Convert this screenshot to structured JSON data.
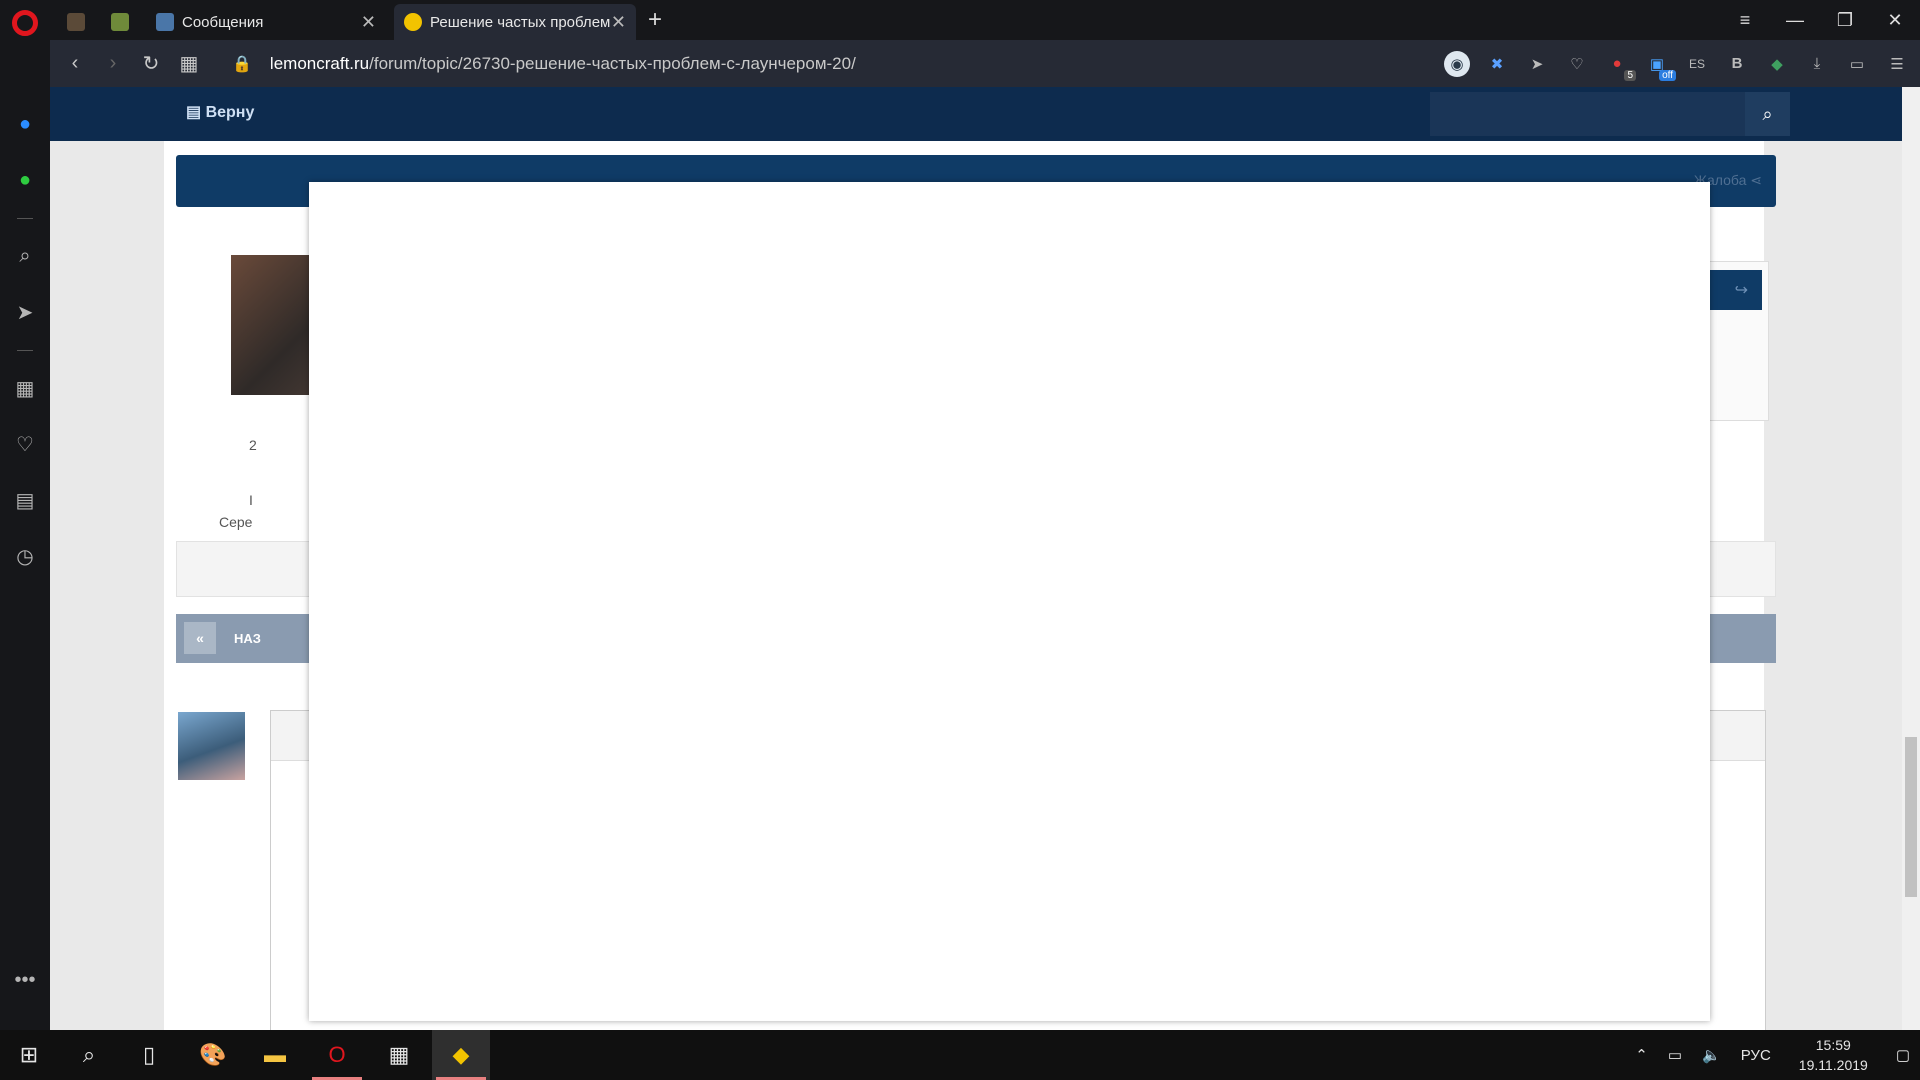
{
  "browser": {
    "tabs": [
      {
        "label": "",
        "icon": "minecraft-character-favicon",
        "pinned": true
      },
      {
        "label": "",
        "icon": "minecraft-block-favicon",
        "pinned": true
      },
      {
        "label": "Сообщения",
        "icon": "vk-messages-favicon",
        "pinned": false
      },
      {
        "label": "Решение частых проблем",
        "icon": "lemon-favicon",
        "pinned": false,
        "active": true
      }
    ],
    "address": {
      "host": "lemoncraft.ru",
      "path": "/forum/topic/26730-решение-частых-проблем-с-лаунчером-20/"
    },
    "extensions": [
      {
        "icon": "camera-icon"
      },
      {
        "icon": "blocker-icon"
      },
      {
        "icon": "send-icon"
      },
      {
        "icon": "heart-icon"
      },
      {
        "icon": "adblock-icon",
        "badge": "5"
      },
      {
        "icon": "sale-off-icon",
        "badge": "off"
      },
      {
        "icon": "es-icon",
        "label": "ES"
      },
      {
        "icon": "b-icon",
        "label": "B"
      },
      {
        "icon": "cube-icon"
      },
      {
        "icon": "download-icon"
      },
      {
        "icon": "battery-icon"
      },
      {
        "icon": "settings-sliders-icon"
      }
    ]
  },
  "page": {
    "back_link": "Верну",
    "report_link": "Жалоба",
    "author_stat": "2",
    "author_rank_line1": "I",
    "author_rank_line2": "Сере",
    "pager_prev": "«",
    "pager_label": "НАЗ"
  },
  "taskbar": {
    "lang": "РУС",
    "time": "15:59",
    "date": "19.11.2019"
  },
  "colors": {
    "brand_dark": "#0d2b4e",
    "opera_red": "#e0161e",
    "accent_blue": "#0f3b66"
  }
}
